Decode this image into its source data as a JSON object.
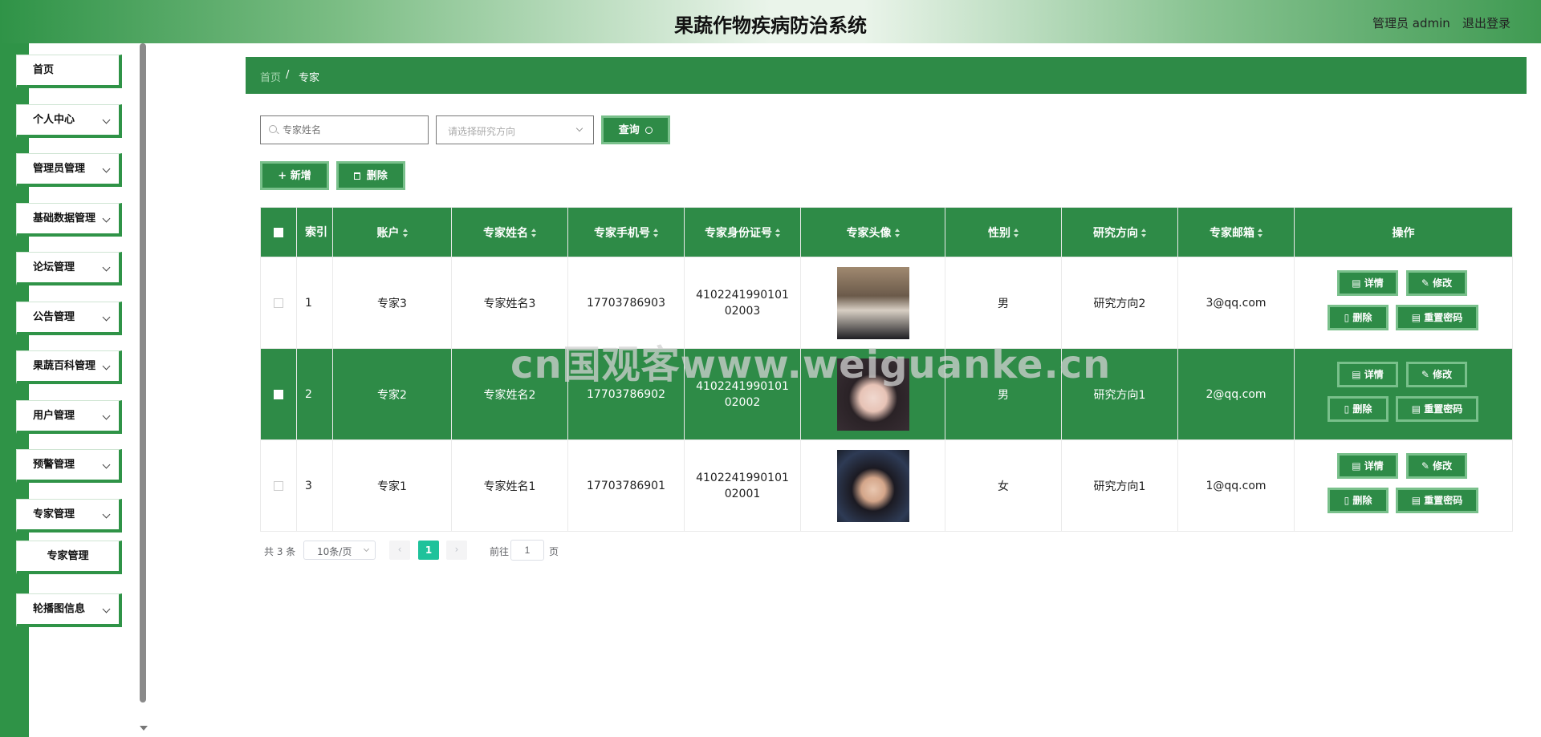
{
  "header": {
    "title": "果蔬作物疾病防治系统",
    "user": "管理员 admin",
    "logout": "退出登录"
  },
  "sidebar": {
    "items": [
      {
        "label": "首页"
      },
      {
        "label": "个人中心"
      },
      {
        "label": "管理员管理"
      },
      {
        "label": "基础数据管理"
      },
      {
        "label": "论坛管理"
      },
      {
        "label": "公告管理"
      },
      {
        "label": "果蔬百科管理"
      },
      {
        "label": "用户管理"
      },
      {
        "label": "预警管理"
      },
      {
        "label": "专家管理"
      },
      {
        "label": "专家管理"
      },
      {
        "label": "轮播图信息"
      }
    ]
  },
  "breadcrumb": {
    "home": "首页",
    "sep": "/",
    "current": "专家"
  },
  "search": {
    "name_placeholder": "专家姓名",
    "direction_placeholder": "请选择研究方向",
    "query": "查询"
  },
  "toolbar": {
    "add": "新增",
    "delete": "删除"
  },
  "table": {
    "headers": [
      "索引",
      "账户",
      "专家姓名",
      "专家手机号",
      "专家身份证号",
      "专家头像",
      "性别",
      "研究方向",
      "专家邮箱",
      "操作"
    ],
    "rows": [
      {
        "index": "1",
        "account": "专家3",
        "name": "专家姓名3",
        "phone": "17703786903",
        "id_card": "410224199010102003",
        "gender": "男",
        "direction": "研究方向2",
        "email": "3@qq.com"
      },
      {
        "index": "2",
        "account": "专家2",
        "name": "专家姓名2",
        "phone": "17703786902",
        "id_card": "410224199010102002",
        "gender": "男",
        "direction": "研究方向1",
        "email": "2@qq.com"
      },
      {
        "index": "3",
        "account": "专家1",
        "name": "专家姓名1",
        "phone": "17703786901",
        "id_card": "410224199010102001",
        "gender": "女",
        "direction": "研究方向1",
        "email": "1@qq.com"
      }
    ],
    "actions": {
      "detail": "详情",
      "edit": "修改",
      "delete": "删除",
      "reset": "重置密码"
    }
  },
  "pagination": {
    "total": "共 3 条",
    "page_size": "10条/页",
    "current": "1",
    "goto": "前往",
    "goto_value": "1",
    "page_unit": "页"
  },
  "watermark": "cn国观客www.weiguanke.cn",
  "colors": {
    "primary": "#2e8b47",
    "pager_active": "#1ec29b"
  }
}
